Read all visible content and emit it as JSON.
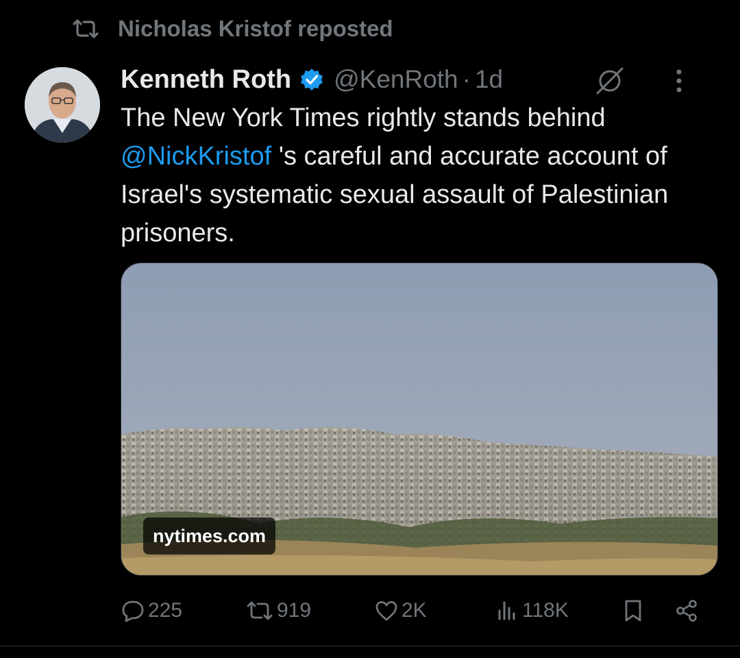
{
  "repost": {
    "text": "Nicholas Kristof reposted"
  },
  "author": {
    "name": "Kenneth Roth",
    "handle": "@KenRoth",
    "separator": "·",
    "time": "1d",
    "verified_color": "#1d9bf0"
  },
  "tweet": {
    "text_before": "The New York Times rightly stands behind ",
    "mention": "@NickKristof",
    "text_after": " 's careful and accurate account of Israel's systematic sexual assault of Palestinian prisoners."
  },
  "media": {
    "domain": "nytimes.com"
  },
  "actions": {
    "replies": "225",
    "reposts": "919",
    "likes": "2K",
    "views": "118K"
  },
  "icons": [
    "repost-icon",
    "verified-badge-icon",
    "grok-icon",
    "more-icon",
    "reply-icon",
    "like-icon",
    "views-icon",
    "bookmark-icon",
    "share-icon"
  ],
  "colors": {
    "background": "#000000",
    "text": "#e7e9ea",
    "secondary": "#71767b",
    "accent": "#1d9bf0"
  }
}
